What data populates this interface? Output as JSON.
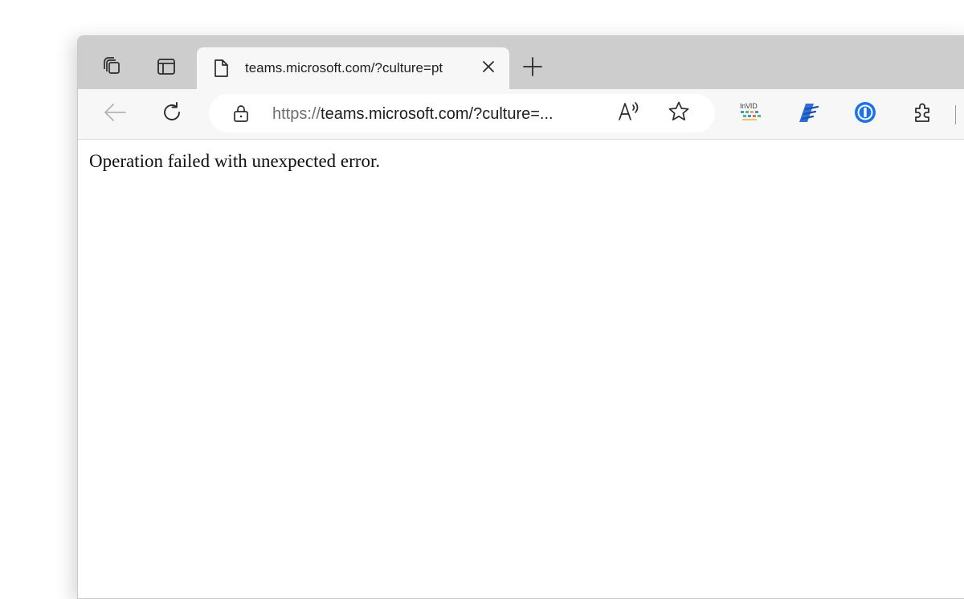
{
  "browser": {
    "tab": {
      "title": "teams.microsoft.com/?culture=pt",
      "close_label": "×"
    },
    "new_tab_label": "+",
    "address_bar": {
      "scheme": "https://",
      "host_path": "teams.microsoft.com/?culture=..."
    },
    "extensions": {
      "invid_label": "InVID"
    },
    "icons": [
      "workspaces-icon",
      "tab-actions-icon",
      "page-icon",
      "close-icon",
      "plus-icon",
      "back-arrow-icon",
      "refresh-icon",
      "lock-icon",
      "read-aloud-icon",
      "favorite-star-icon",
      "invid-extension-icon",
      "pen-extension-icon",
      "password-manager-icon",
      "extensions-puzzle-icon"
    ]
  },
  "page": {
    "message": "Operation failed with unexpected error."
  }
}
